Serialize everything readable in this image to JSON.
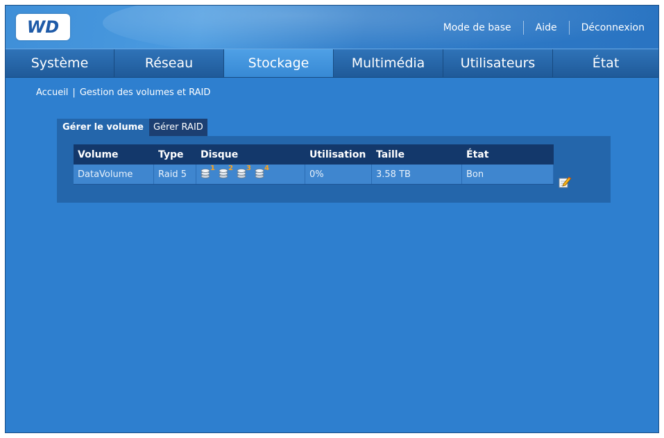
{
  "header": {
    "logo_text": "WD",
    "links": [
      {
        "label": "Mode de base"
      },
      {
        "label": "Aide"
      },
      {
        "label": "Déconnexion"
      }
    ]
  },
  "nav": {
    "tabs": [
      {
        "label": "Système",
        "active": false
      },
      {
        "label": "Réseau",
        "active": false
      },
      {
        "label": "Stockage",
        "active": true
      },
      {
        "label": "Multimédia",
        "active": false
      },
      {
        "label": "Utilisateurs",
        "active": false
      },
      {
        "label": "État",
        "active": false
      }
    ]
  },
  "breadcrumb": {
    "home": "Accueil",
    "separator": "|",
    "current": "Gestion des volumes et RAID"
  },
  "subtabs": {
    "manage_volume": "Gérer le volume",
    "manage_raid": "Gérer RAID"
  },
  "table": {
    "headers": {
      "volume": "Volume",
      "type": "Type",
      "disk": "Disque",
      "usage": "Utilisation",
      "size": "Taille",
      "status": "État"
    },
    "rows": [
      {
        "volume": "DataVolume",
        "type": "Raid 5",
        "disks": [
          "1",
          "2",
          "3",
          "4"
        ],
        "usage": "0%",
        "size": "3.58 TB",
        "status": "Bon"
      }
    ]
  },
  "icons": {
    "disk": "disk-stack-icon",
    "edit": "edit-pencil-icon"
  },
  "colors": {
    "background": "#2e7fcf",
    "nav_active": "#3789d4",
    "table_header": "#13386b",
    "table_row": "#3f86cf",
    "disk_badge": "#ffa21a"
  }
}
